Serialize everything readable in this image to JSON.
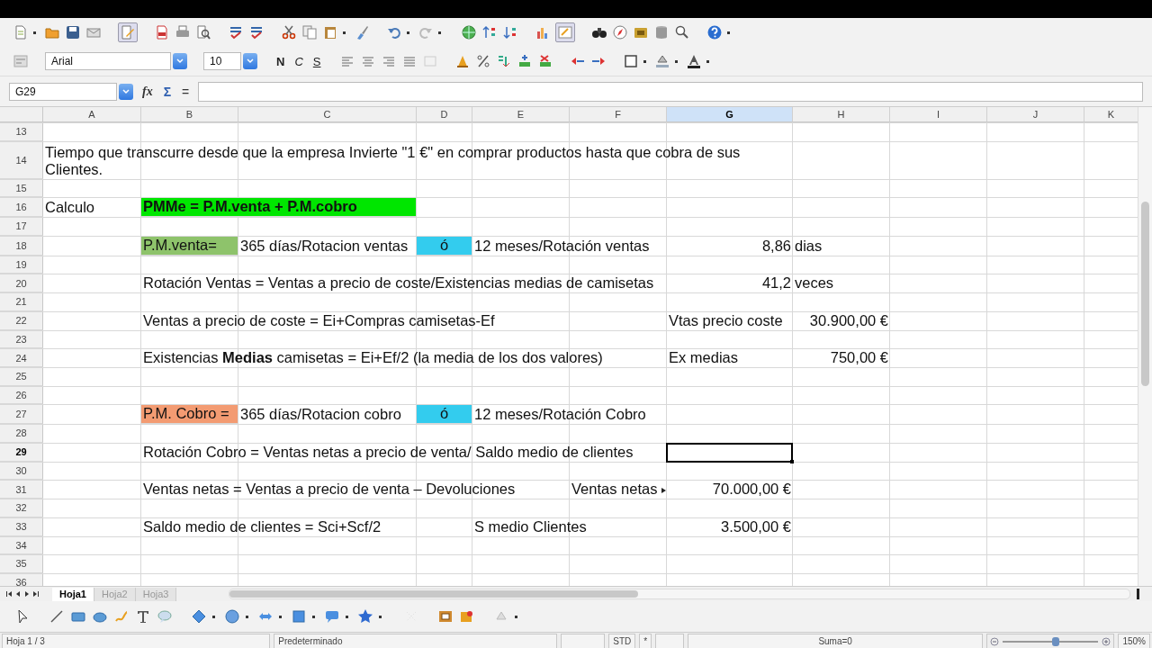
{
  "formatting_toolbar": {
    "font_name": "Arial",
    "font_size": "10",
    "style_buttons": [
      {
        "label": "N",
        "kind": "bold"
      },
      {
        "label": "C",
        "kind": "italic"
      },
      {
        "label": "S",
        "kind": "underline"
      }
    ]
  },
  "formula_bar": {
    "name_box": "G29",
    "function_wizard": "fx",
    "sum": "Σ",
    "formula": "="
  },
  "sheet": {
    "columns": [
      {
        "label": "A",
        "selected": false
      },
      {
        "label": "B",
        "selected": false
      },
      {
        "label": "C",
        "selected": false
      },
      {
        "label": "D",
        "selected": false
      },
      {
        "label": "E",
        "selected": false
      },
      {
        "label": "F",
        "selected": false
      },
      {
        "label": "G",
        "selected": true
      },
      {
        "label": "H",
        "selected": false
      },
      {
        "label": "I",
        "selected": false
      },
      {
        "label": "J",
        "selected": false
      },
      {
        "label": "K",
        "selected": false
      }
    ],
    "rows": [
      {
        "number": "13",
        "selected": false
      },
      {
        "number": "14",
        "selected": false,
        "cells": {
          "A": {
            "text": "Tiempo que transcurre desde que la empresa Invierte \"1 €\" en comprar productos hasta que cobra de sus Clientes.",
            "kind": "text",
            "wrap": true
          }
        }
      },
      {
        "number": "15",
        "selected": false
      },
      {
        "number": "16",
        "selected": false,
        "cells": {
          "A": {
            "text": "Calculo",
            "kind": "text"
          },
          "B": {
            "text": "PMMe = P.M.venta + P.M.cobro",
            "kind": "text",
            "bold": true,
            "color": "#00e600"
          }
        }
      },
      {
        "number": "17",
        "selected": false
      },
      {
        "number": "18",
        "selected": false,
        "cells": {
          "B": {
            "text": "P.M.venta=",
            "kind": "text",
            "color": "#8ec36b"
          },
          "C": {
            "text": "365 días/Rotacion ventas",
            "kind": "text"
          },
          "D": {
            "text": "ó",
            "kind": "center",
            "color": "#33ccee"
          },
          "E": {
            "text": "12 meses/Rotación ventas",
            "kind": "text"
          },
          "G": {
            "text": "8,86",
            "kind": "number"
          },
          "H": {
            "text": "dias",
            "kind": "text"
          }
        }
      },
      {
        "number": "19",
        "selected": false
      },
      {
        "number": "20",
        "selected": false,
        "cells": {
          "B": {
            "text": "Rotación Ventas = Ventas a precio de coste/Existencias medias de camisetas",
            "kind": "text"
          },
          "G": {
            "text": "41,2",
            "kind": "number"
          },
          "H": {
            "text": "veces",
            "kind": "text"
          }
        }
      },
      {
        "number": "21",
        "selected": false
      },
      {
        "number": "22",
        "selected": false,
        "cells": {
          "B": {
            "text": "Ventas a precio de coste = Ei+Compras camisetas-Ef",
            "kind": "text"
          },
          "G": {
            "text": "Vtas precio coste",
            "kind": "text"
          },
          "H": {
            "text": "30.900,00 €",
            "kind": "number"
          }
        }
      },
      {
        "number": "23",
        "selected": false
      },
      {
        "number": "24",
        "selected": false,
        "cells": {
          "B": {
            "text": "Existencias **Medias** camisetas = Ei+Ef/2 (la media de los dos valores)",
            "kind": "text"
          },
          "G": {
            "text": "Ex medias",
            "kind": "text"
          },
          "H": {
            "text": "750,00 €",
            "kind": "number"
          }
        }
      },
      {
        "number": "25",
        "selected": false
      },
      {
        "number": "26",
        "selected": false
      },
      {
        "number": "27",
        "selected": false,
        "cells": {
          "B": {
            "text": "P.M. Cobro =",
            "kind": "text",
            "color": "#f39b72"
          },
          "C": {
            "text": "365 días/Rotacion cobro",
            "kind": "text"
          },
          "D": {
            "text": "ó",
            "kind": "center",
            "color": "#33ccee"
          },
          "E": {
            "text": "12 meses/Rotación Cobro",
            "kind": "text"
          }
        }
      },
      {
        "number": "28",
        "selected": false
      },
      {
        "number": "29",
        "selected": true,
        "cells": {
          "B": {
            "text": "Rotación Cobro = Ventas netas a precio de venta/ Saldo medio de clientes",
            "kind": "text"
          }
        }
      },
      {
        "number": "30",
        "selected": false
      },
      {
        "number": "31",
        "selected": false,
        "cells": {
          "B": {
            "text": "Ventas netas = Ventas a precio de venta – Devoluciones",
            "kind": "text"
          },
          "F": {
            "text": "Ventas netas",
            "kind": "text",
            "clipped": true
          },
          "G": {
            "text": "70.000,00 €",
            "kind": "number"
          }
        }
      },
      {
        "number": "32",
        "selected": false
      },
      {
        "number": "33",
        "selected": false,
        "cells": {
          "B": {
            "text": "Saldo medio de clientes = Sci+Scf/2",
            "kind": "text"
          },
          "E": {
            "text": "S medio Clientes",
            "kind": "text"
          },
          "G": {
            "text": "3.500,00 €",
            "kind": "number"
          }
        }
      },
      {
        "number": "34",
        "selected": false
      },
      {
        "number": "35",
        "selected": false
      },
      {
        "number": "36",
        "selected": false
      }
    ]
  },
  "sheet_tabs": [
    {
      "label": "Hoja1",
      "selected": true
    },
    {
      "label": "Hoja2",
      "selected": false
    },
    {
      "label": "Hoja3",
      "selected": false
    }
  ],
  "status_bar": {
    "sheet": "Hoja 1 / 3",
    "page_style": "Predeterminado",
    "mode": "STD",
    "modified": "*",
    "sum": "Suma=0",
    "zoom": {
      "level": 0.55
    },
    "zoom_label": "150%"
  }
}
